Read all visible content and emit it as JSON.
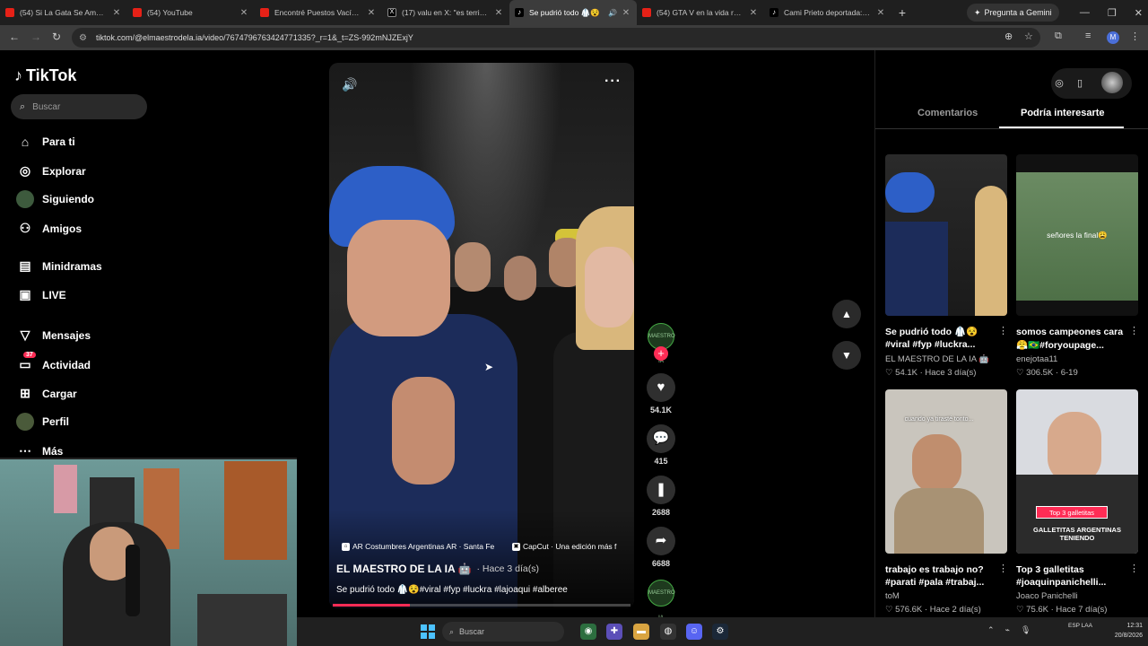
{
  "browser": {
    "tabs": [
      {
        "favicon": "youtube-icon",
        "title": "(54) Si La Gata Se Amotina...",
        "active": false
      },
      {
        "favicon": "youtube-icon",
        "title": "(54) YouTube",
        "active": false
      },
      {
        "favicon": "youtube-icon",
        "title": "Encontré Puestos Vacíos y...",
        "active": false
      },
      {
        "favicon": "x-icon",
        "title": "(17) valu en X: \"es terrible...",
        "active": false
      },
      {
        "favicon": "tiktok-icon",
        "title": "Se pudrió todo 🥼😵",
        "active": true
      },
      {
        "favicon": "youtube-icon",
        "title": "(54) GTA V en la vida real...",
        "active": false
      },
      {
        "favicon": "tiktok-icon",
        "title": "Cami Prieto deportada: qu...",
        "active": false
      }
    ],
    "gemini_label": "Pregunta a Gemini",
    "url": "tiktok.com/@elmaestrodela.ia/video/7674796763424771335?_r=1&_t=ZS-992mNJZExjY",
    "profile_initial": "M"
  },
  "tiktok": {
    "logo": "TikTok",
    "search_placeholder": "Buscar",
    "nav": [
      {
        "icon": "home-icon",
        "label": "Para ti"
      },
      {
        "icon": "compass-icon",
        "label": "Explorar"
      },
      {
        "icon": "avatar",
        "label": "Siguiendo"
      },
      {
        "icon": "friends-icon",
        "label": "Amigos"
      },
      {
        "icon": "minidramas-icon",
        "label": "Minidramas"
      },
      {
        "icon": "live-icon",
        "label": "LIVE"
      },
      {
        "icon": "send-icon",
        "label": "Mensajes"
      },
      {
        "icon": "inbox-icon",
        "label": "Actividad",
        "badge": "37"
      },
      {
        "icon": "upload-icon",
        "label": "Cargar"
      },
      {
        "icon": "avatar",
        "label": "Perfil"
      },
      {
        "icon": "more-icon",
        "label": "Más"
      }
    ],
    "video": {
      "tags": [
        "AR Costumbres Argentinas AR · Santa Fe",
        "CapCut · Una edición más f"
      ],
      "author": "EL MAESTRO DE LA IA 🤖",
      "posted": "· Hace 3 día(s)",
      "caption": "Se pudrió todo 🥼😵#viral #fyp #luckra #lajoaqui #alberee",
      "progress": 0.26
    },
    "actions": {
      "likes": "54.1K",
      "comments": "415",
      "saves": "2688",
      "shares": "6688",
      "creator_avatar_text": "MAESTRO IA"
    },
    "right_panel": {
      "tabs": [
        "Comentarios",
        "Podría interesarte"
      ],
      "active_tab": "Podría interesarte",
      "cards": [
        {
          "title": "Se pudrió todo 🥼😵",
          "title2": "#viral #fyp #luckra...",
          "author": "EL MAESTRO DE LA IA 🤖",
          "meta": "♡ 54.1K · Hace 3 día(s)",
          "thumb_text": ""
        },
        {
          "title": "somos campeones cara",
          "title2": "😤🇧🇷#foryoupage...",
          "author": "enejotaa11",
          "meta": "♡ 306.5K · 6-19",
          "thumb_text": "señores la final😩"
        },
        {
          "title": "trabajo es trabajo no?",
          "title2": "#parati #pala #trabaj...",
          "author": "toM",
          "meta": "♡ 576.6K · Hace 2 día(s)",
          "thumb_text": "cuando ya tirasté tonto..."
        },
        {
          "title": "Top 3 galletitas",
          "title2": "#joaquinpanichelli...",
          "author": "Joaco Panichelli",
          "meta": "♡ 75.6K · Hace 7 día(s)",
          "thumb_text": "Top 3 galletitas"
        }
      ],
      "card4_overlay": "GALLETITAS ARGENTINAS TENIENDO"
    }
  },
  "taskbar": {
    "search_placeholder": "Buscar",
    "lang": "ESP LAA",
    "time": "12:31",
    "date": "20/8/2026"
  }
}
